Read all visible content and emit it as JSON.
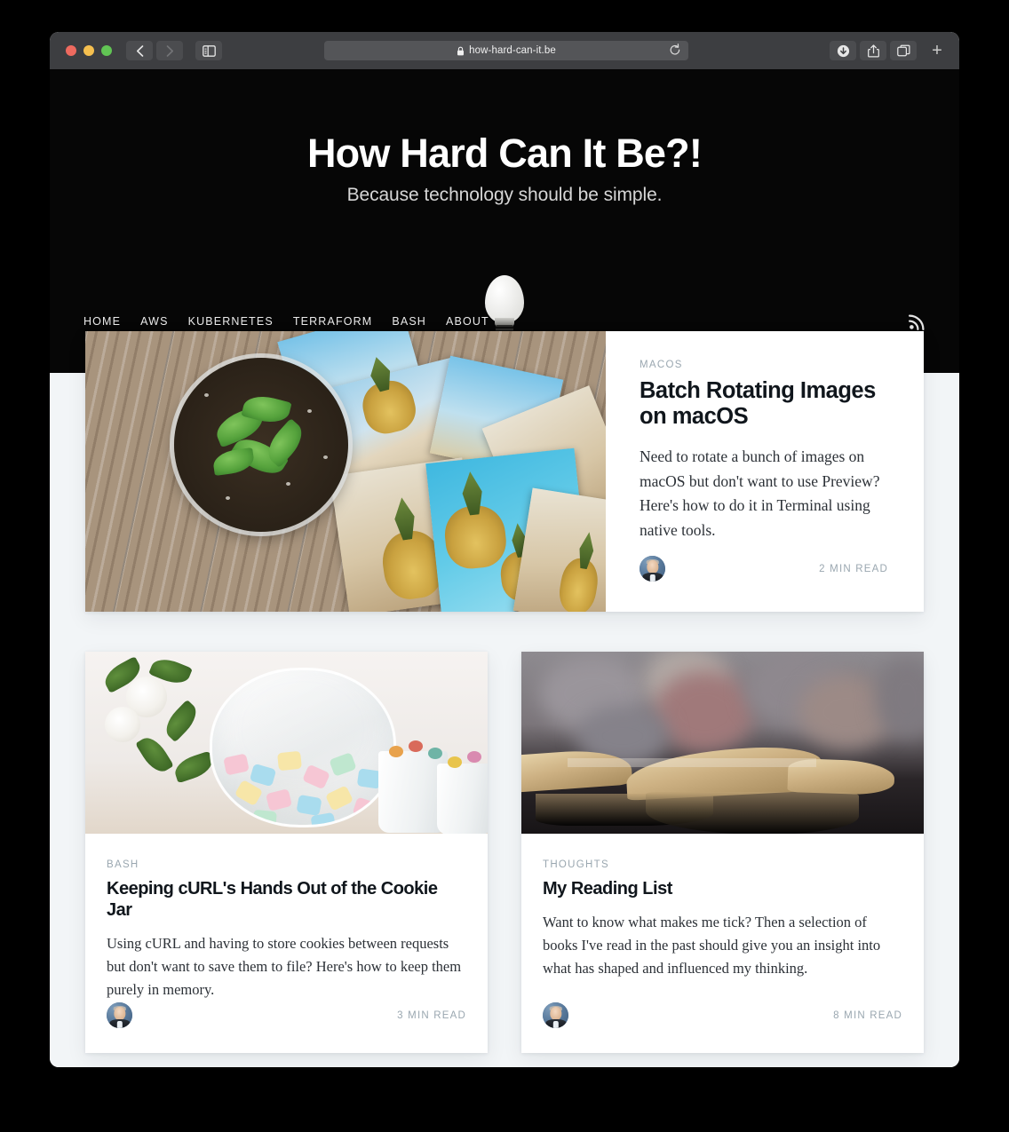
{
  "browser": {
    "url": "how-hard-can-it.be",
    "nav_back_label": "Back",
    "nav_forward_label": "Forward",
    "sidebar_label": "Show Sidebar",
    "reload_label": "Reload",
    "downloads_label": "Downloads",
    "share_label": "Share",
    "tab_overview_label": "Tab Overview",
    "new_tab_label": "+",
    "colors": {
      "toolbar": "#3d3e41",
      "close": "#ee6a5f",
      "minimize": "#f5bf4f",
      "zoom": "#61c454"
    }
  },
  "site": {
    "title": "How Hard Can It Be?!",
    "tagline": "Because technology should be simple.",
    "nav": [
      {
        "label": "HOME"
      },
      {
        "label": "AWS"
      },
      {
        "label": "KUBERNETES"
      },
      {
        "label": "TERRAFORM"
      },
      {
        "label": "BASH"
      },
      {
        "label": "ABOUT"
      }
    ],
    "rss_label": "RSS"
  },
  "featured_post": {
    "tag": "MACOS",
    "title": "Batch Rotating Images on macOS",
    "excerpt": "Need to rotate a bunch of images on macOS but don't want to use Preview? Here's how to do it in Terminal using native tools.",
    "read_time": "2 MIN READ",
    "image_alt": "printed photos of pineapples and beaches scattered on weathered wood with a glass terrarium"
  },
  "posts": [
    {
      "tag": "BASH",
      "title": "Keeping cURL's Hands Out of the Cookie Jar",
      "excerpt": "Using cURL and having to store cookies between requests but don't want to save them to file? Here's how to keep them purely in memory.",
      "read_time": "3 MIN READ",
      "image_alt": "glass cookie jar filled with pastel marshmallows beside white flowers"
    },
    {
      "tag": "THOUGHTS",
      "title": "My Reading List",
      "excerpt": "Want to know what makes me tick? Then a selection of books I've read in the past should give you an insight into what has shaped and influenced my thinking.",
      "read_time": "8 MIN READ",
      "image_alt": "open book resting on a reflective dark surface"
    }
  ]
}
